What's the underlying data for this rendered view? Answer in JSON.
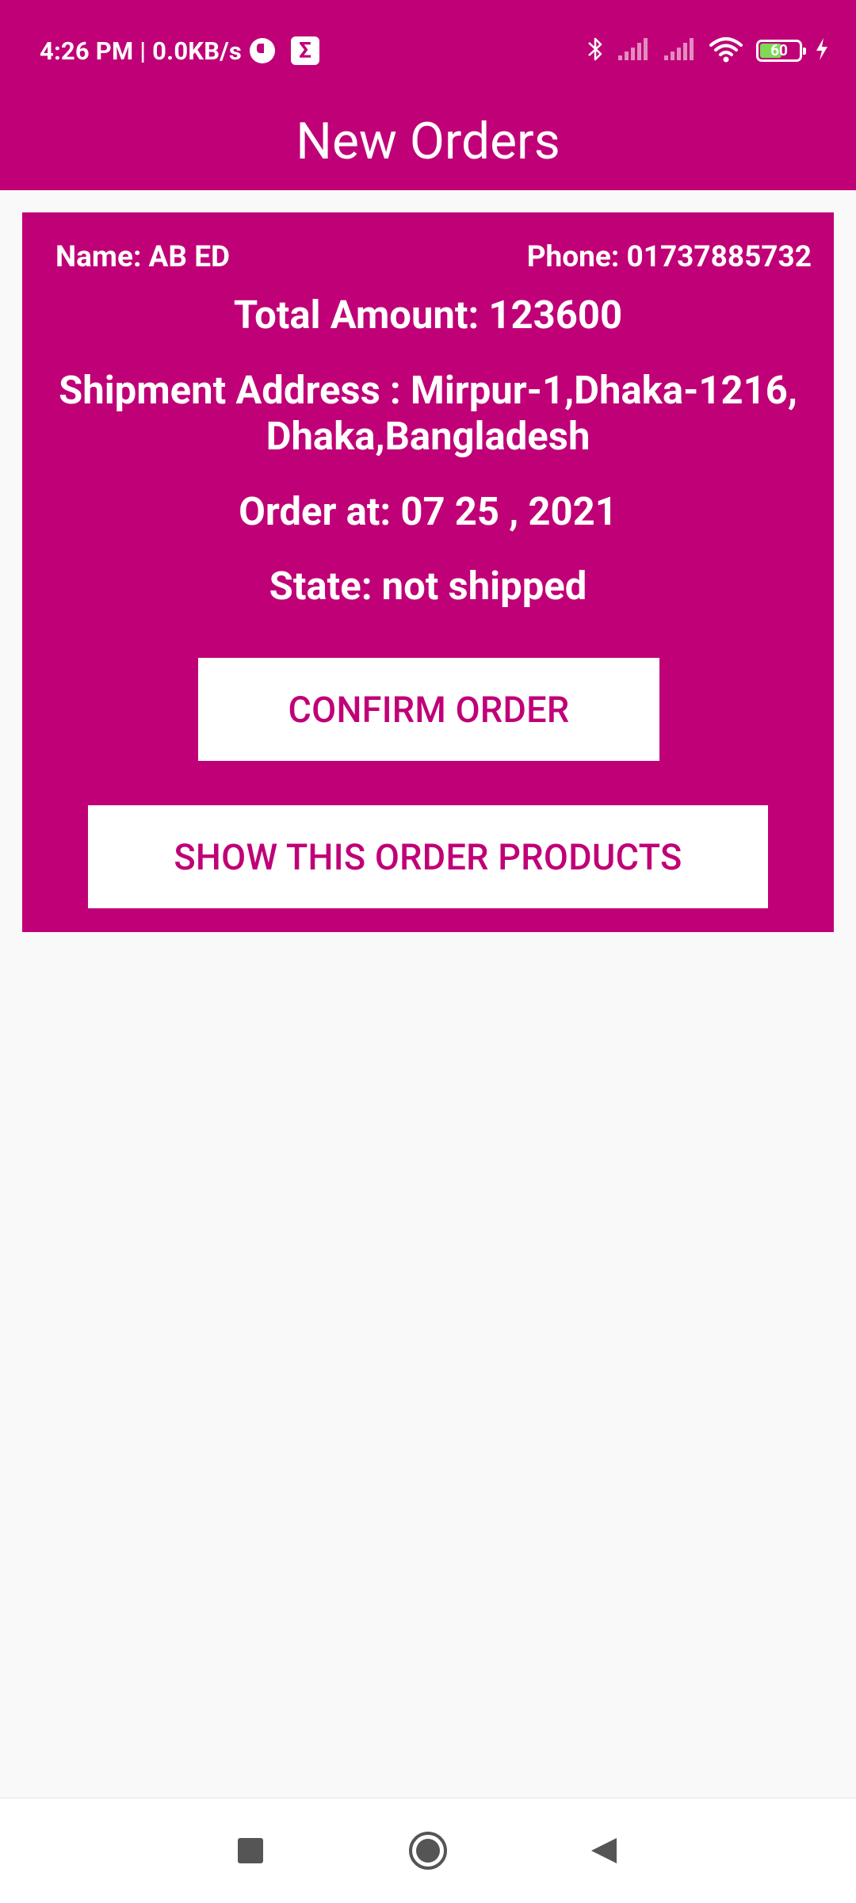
{
  "status_bar": {
    "time_speed": "4:26 PM | 0.0KB/s",
    "battery": "60",
    "battery_level": 0.6,
    "icons": [
      "data-saver-icon",
      "sigma-icon",
      "bluetooth-icon",
      "signal-icon",
      "signal-icon",
      "wifi-icon",
      "battery-icon",
      "charging-icon"
    ]
  },
  "app_bar": {
    "title": "New Orders"
  },
  "order": {
    "name": "Name: AB ED",
    "phone": "Phone: 01737885732",
    "total_amount": "Total Amount: 123600",
    "address_line1": "Shipment Address : Mirpur-1,Dhaka-1216,",
    "address_line2": "Dhaka,Bangladesh",
    "order_date": "Order at: 07 25 , 2021",
    "state": "State: not shipped",
    "confirm_button": "CONFIRM ORDER",
    "show_products_button": "SHOW THIS ORDER PRODUCTS"
  },
  "nav_bar": {
    "icons": [
      "recent-apps-icon",
      "home-icon",
      "back-icon"
    ]
  },
  "colors": {
    "accent": "#c00077",
    "background": "#f9f9f9",
    "button_bg": "#ffffff"
  }
}
